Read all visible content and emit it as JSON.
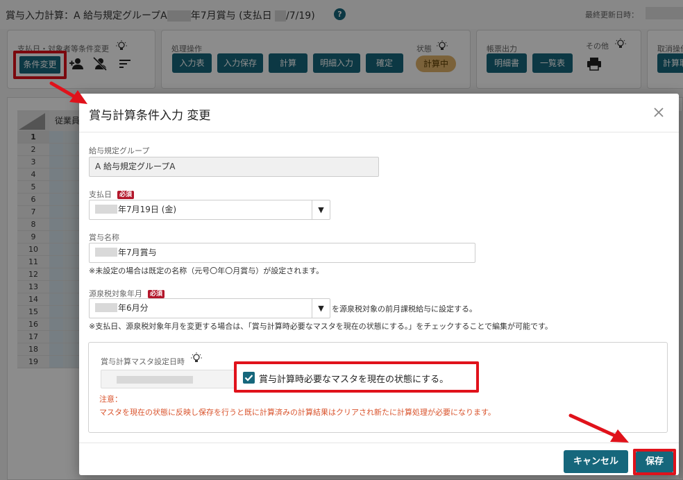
{
  "header": {
    "title_prefix": "賞与入力計算：A 給与規定グループA",
    "title_middle": "年7月賞与 (支払日",
    "title_suffix": "/7/19)",
    "help": "?",
    "last_updated_label": "最終更新日時："
  },
  "toolbar": {
    "condition_group_label": "支払日・対象者等条件変更",
    "condition_change": "条件変更",
    "process_group_label": "処理操作",
    "input_table": "入力表",
    "input_save": "入力保存",
    "calculate": "計算",
    "detail_input": "明細入力",
    "confirm": "確定",
    "status_label": "状態",
    "status_value": "計算中",
    "report_group_label": "帳票出力",
    "payslip": "明細書",
    "list": "一覧表",
    "other_label": "その他",
    "cancel_group_label": "取消操作",
    "cancel_calc": "計算取"
  },
  "grid": {
    "column_header": "従業員",
    "rows": [
      "1",
      "2",
      "3",
      "4",
      "5",
      "6",
      "7",
      "8",
      "9",
      "10",
      "11",
      "12",
      "13",
      "14",
      "15",
      "16",
      "17",
      "18",
      "19"
    ]
  },
  "modal": {
    "title": "賞与計算条件入力 変更",
    "group_label": "給与規定グループ",
    "group_value": "A 給与規定グループA",
    "pay_date_label": "支払日",
    "required": "必須",
    "pay_date_value": "年7月19日 (金)",
    "bonus_name_label": "賞与名称",
    "bonus_name_value": "年7月賞与",
    "bonus_name_hint": "※未設定の場合は既定の名称（元号〇年〇月賞与）が設定されます。",
    "withholding_label": "源泉税対象年月",
    "withholding_value": "年6月分",
    "withholding_side_text": "を源泉税対象の前月課税給与に設定する。",
    "withholding_hint": "※支払日、源泉税対象年月を変更する場合は、「賞与計算時必要なマスタを現在の状態にする。」をチェックすることで編集が可能です。",
    "master_date_label": "賞与計算マスタ設定日時",
    "checkbox_label": "賞与計算時必要なマスタを現在の状態にする。",
    "checkbox_checked": true,
    "warning_title": "注意：",
    "warning_text": "マスタを現在の状態に反映し保存を行うと既に計算済みの計算結果はクリアされ新たに計算処理が必要になります。",
    "cancel": "キャンセル",
    "save": "保存"
  },
  "colors": {
    "primary": "#16677c",
    "highlight": "#e0121b",
    "warning": "#d9532c",
    "status": "#e1b26a"
  }
}
